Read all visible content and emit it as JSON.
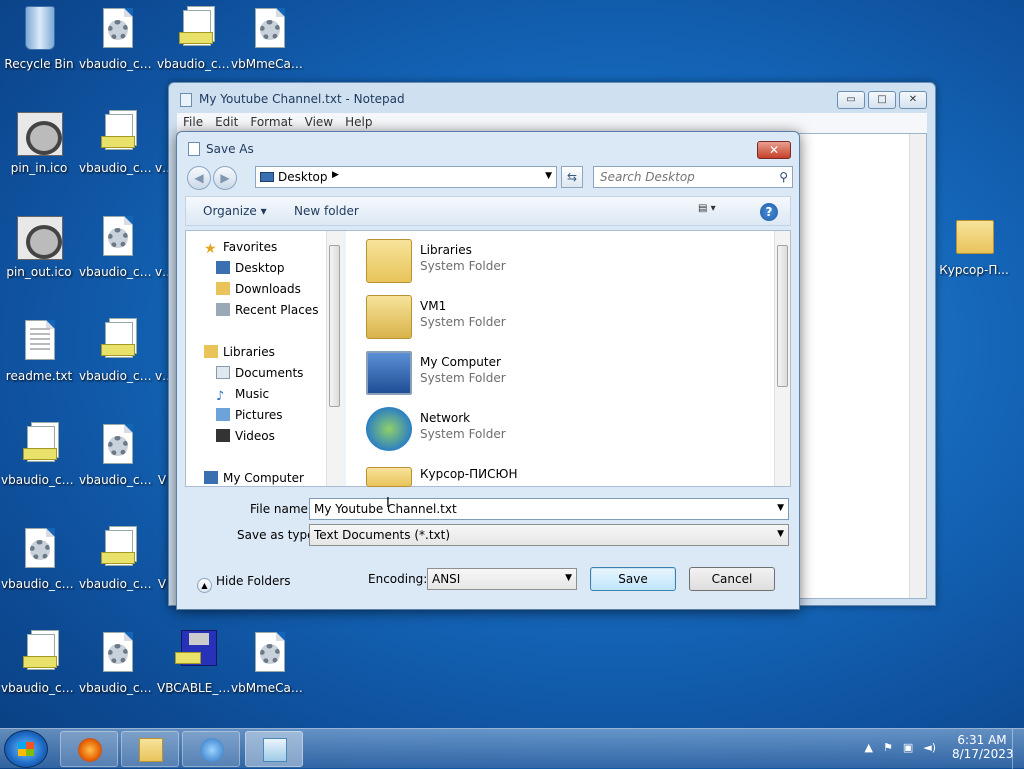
{
  "desktop": {
    "icons": [
      {
        "label": "Recycle Bin"
      },
      {
        "label": "vbaudio_ca..."
      },
      {
        "label": "vbaudio_ca..."
      },
      {
        "label": "vbMmeCab..."
      },
      {
        "label": "pin_in.ico"
      },
      {
        "label": "vbaudio_ca..."
      },
      {
        "label": "vb"
      },
      {
        "label": "pin_out.ico"
      },
      {
        "label": "vbaudio_ca..."
      },
      {
        "label": "vb"
      },
      {
        "label": "readme.txt"
      },
      {
        "label": "vbaudio_ca..."
      },
      {
        "label": "vb"
      },
      {
        "label": "vbaudio_ca..."
      },
      {
        "label": "vbaudio_ca..."
      },
      {
        "label": "V"
      },
      {
        "label": "vbaudio_ca..."
      },
      {
        "label": "vbaudio_ca..."
      },
      {
        "label": "V"
      },
      {
        "label": "vbaudio_ca..."
      },
      {
        "label": "vbaudio_ca..."
      },
      {
        "label": "VBCABLE_S..."
      },
      {
        "label": "vbMmeCab..."
      },
      {
        "label": "Курсор-П..."
      }
    ]
  },
  "notepad": {
    "title": "My Youtube Channel.txt - Notepad",
    "menu": [
      "File",
      "Edit",
      "Format",
      "View",
      "Help"
    ],
    "buttons": {
      "minimize": "▭",
      "maximize": "□",
      "close": "✕"
    }
  },
  "dialog": {
    "title": "Save As",
    "close": "✕",
    "address": "Desktop",
    "search_placeholder": "Search Desktop",
    "toolbar": {
      "organize": "Organize ▾",
      "new_folder": "New folder",
      "views": "▤ ▾",
      "help": "?"
    },
    "tree": {
      "favorites": "Favorites",
      "desktop": "Desktop",
      "downloads": "Downloads",
      "recent": "Recent Places",
      "libraries": "Libraries",
      "documents": "Documents",
      "music": "Music",
      "pictures": "Pictures",
      "videos": "Videos",
      "computer": "My Computer"
    },
    "files": [
      {
        "name": "Libraries",
        "type": "System Folder"
      },
      {
        "name": "VM1",
        "type": "System Folder"
      },
      {
        "name": "My Computer",
        "type": "System Folder"
      },
      {
        "name": "Network",
        "type": "System Folder"
      },
      {
        "name": "Курсор-ПИСЮН",
        "type": ""
      }
    ],
    "file_name_label": "File name:",
    "file_name_value": "My Youtube Channel.txt",
    "save_type_label": "Save as type:",
    "save_type_value": "Text Documents (*.txt)",
    "hide_folders": "Hide Folders",
    "encoding_label": "Encoding:",
    "encoding_value": "ANSI",
    "save": "Save",
    "cancel": "Cancel"
  },
  "taskbar": {
    "time": "6:31 AM",
    "date": "8/17/2023"
  }
}
